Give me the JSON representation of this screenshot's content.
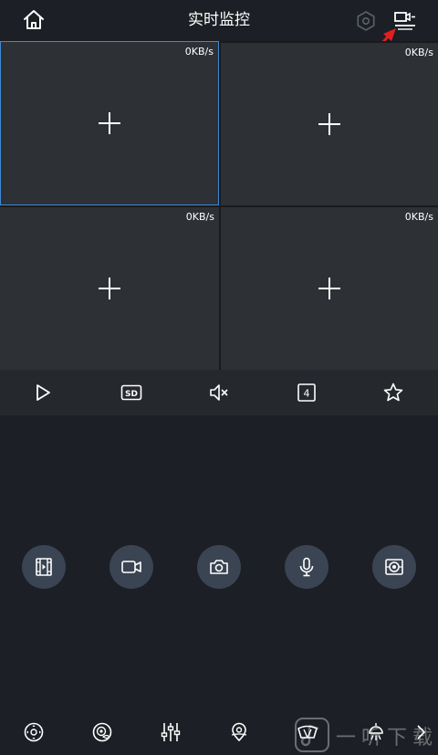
{
  "header": {
    "title": "实时监控",
    "icons": [
      "home-icon",
      "settings-icon",
      "split-screen-icon"
    ]
  },
  "cells": [
    {
      "rate": "0KB/s",
      "selected": true
    },
    {
      "rate": "0KB/s",
      "selected": false
    },
    {
      "rate": "0KB/s",
      "selected": false
    },
    {
      "rate": "0KB/s",
      "selected": false
    }
  ],
  "toolbar": {
    "sd_label": "SD",
    "split_count": "4",
    "icons": [
      "play-icon",
      "sd-quality-icon",
      "mute-icon",
      "split-count-icon",
      "favorite-star-icon"
    ]
  },
  "controls": {
    "icons": [
      "playback-film-icon",
      "record-video-icon",
      "snapshot-camera-icon",
      "microphone-icon",
      "fisheye-icon"
    ]
  },
  "bottom_bar": {
    "icons": [
      "ptz-direction-icon",
      "eye-view-icon",
      "sliders-adjust-icon",
      "location-pin-icon",
      "wiper-icon",
      "light-icon"
    ]
  },
  "watermark": {
    "text": "一听下载"
  },
  "colors": {
    "background": "#1c1f25",
    "cell": "#2d3035",
    "toolbar": "#25282d",
    "selected_border": "#3f88d4",
    "control_circle": "#3a4452",
    "annotation_arrow": "#e02020"
  }
}
